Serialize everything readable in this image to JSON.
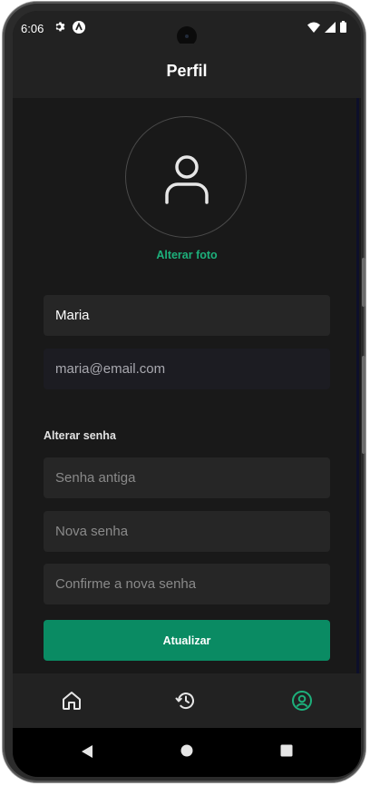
{
  "status_bar": {
    "time": "6:06",
    "left_icons": [
      "gear-icon",
      "app-badge-icon"
    ],
    "right_icons": [
      "wifi-icon",
      "signal-icon",
      "battery-icon"
    ]
  },
  "header": {
    "title": "Perfil"
  },
  "avatar": {
    "icon": "user-icon",
    "change_photo_label": "Alterar foto"
  },
  "form": {
    "name_value": "Maria",
    "email_value": "maria@email.com",
    "password_section_label": "Alterar senha",
    "old_password_placeholder": "Senha antiga",
    "new_password_placeholder": "Nova senha",
    "confirm_password_placeholder": "Confirme a nova senha",
    "submit_label": "Atualizar"
  },
  "tabs": [
    {
      "name": "home",
      "icon": "home-icon",
      "active": false
    },
    {
      "name": "history",
      "icon": "history-icon",
      "active": false
    },
    {
      "name": "profile",
      "icon": "user-circle-icon",
      "active": true
    }
  ],
  "colors": {
    "accent": "#1db07b",
    "button": "#0a8b63",
    "background": "#191919",
    "surface": "#222222",
    "input": "#262626"
  }
}
